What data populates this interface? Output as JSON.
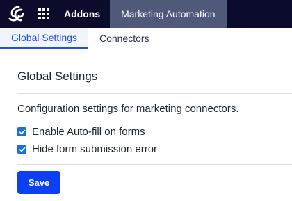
{
  "topbar": {
    "logo_icon": "brand-logo-icon",
    "apps_icon": "apps-grid-icon",
    "addons_label": "Addons",
    "active_label": "Marketing Automation",
    "background": "#0b0b2b",
    "active_background": "#51597a"
  },
  "tabs": [
    {
      "label": "Global Settings",
      "active": true
    },
    {
      "label": "Connectors",
      "active": false
    }
  ],
  "section": {
    "title": "Global Settings",
    "description": "Configuration settings for marketing connectors.",
    "options": [
      {
        "label": "Enable Auto-fill on forms",
        "checked": true
      },
      {
        "label": "Hide form submission error",
        "checked": true
      }
    ],
    "save_label": "Save"
  },
  "colors": {
    "accent": "#1b53d6",
    "checkbox": "#1b6fdc",
    "button": "#0d3ff5"
  }
}
